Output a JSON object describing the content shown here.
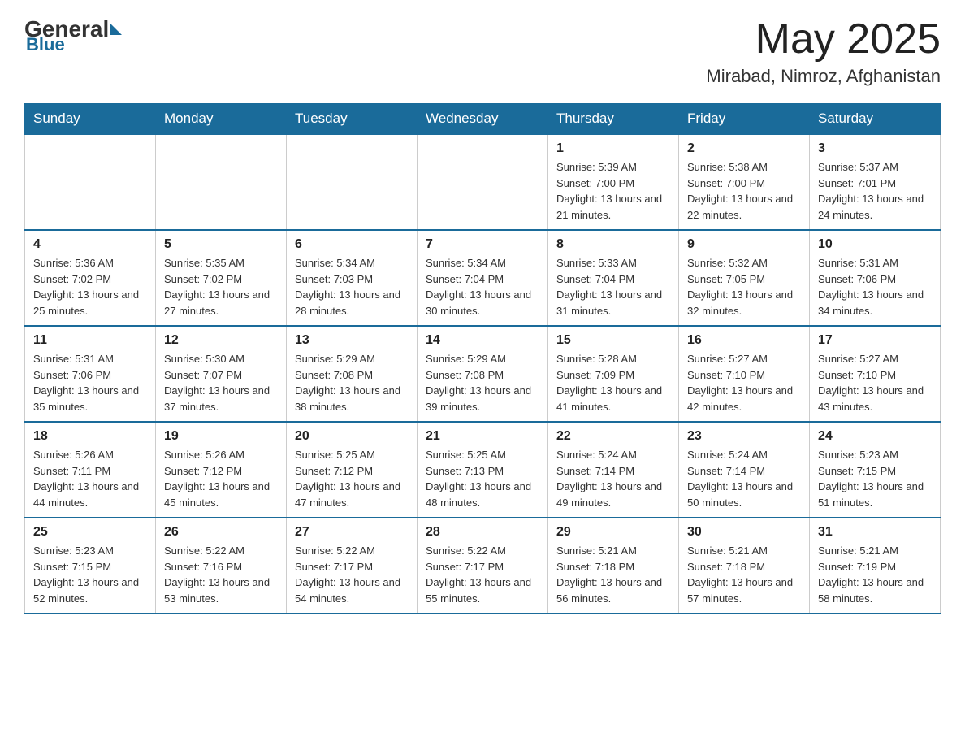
{
  "header": {
    "logo_general": "General",
    "logo_blue": "Blue",
    "month_year": "May 2025",
    "location": "Mirabad, Nimroz, Afghanistan"
  },
  "weekdays": [
    "Sunday",
    "Monday",
    "Tuesday",
    "Wednesday",
    "Thursday",
    "Friday",
    "Saturday"
  ],
  "weeks": [
    [
      {
        "day": "",
        "info": ""
      },
      {
        "day": "",
        "info": ""
      },
      {
        "day": "",
        "info": ""
      },
      {
        "day": "",
        "info": ""
      },
      {
        "day": "1",
        "info": "Sunrise: 5:39 AM\nSunset: 7:00 PM\nDaylight: 13 hours and 21 minutes."
      },
      {
        "day": "2",
        "info": "Sunrise: 5:38 AM\nSunset: 7:00 PM\nDaylight: 13 hours and 22 minutes."
      },
      {
        "day": "3",
        "info": "Sunrise: 5:37 AM\nSunset: 7:01 PM\nDaylight: 13 hours and 24 minutes."
      }
    ],
    [
      {
        "day": "4",
        "info": "Sunrise: 5:36 AM\nSunset: 7:02 PM\nDaylight: 13 hours and 25 minutes."
      },
      {
        "day": "5",
        "info": "Sunrise: 5:35 AM\nSunset: 7:02 PM\nDaylight: 13 hours and 27 minutes."
      },
      {
        "day": "6",
        "info": "Sunrise: 5:34 AM\nSunset: 7:03 PM\nDaylight: 13 hours and 28 minutes."
      },
      {
        "day": "7",
        "info": "Sunrise: 5:34 AM\nSunset: 7:04 PM\nDaylight: 13 hours and 30 minutes."
      },
      {
        "day": "8",
        "info": "Sunrise: 5:33 AM\nSunset: 7:04 PM\nDaylight: 13 hours and 31 minutes."
      },
      {
        "day": "9",
        "info": "Sunrise: 5:32 AM\nSunset: 7:05 PM\nDaylight: 13 hours and 32 minutes."
      },
      {
        "day": "10",
        "info": "Sunrise: 5:31 AM\nSunset: 7:06 PM\nDaylight: 13 hours and 34 minutes."
      }
    ],
    [
      {
        "day": "11",
        "info": "Sunrise: 5:31 AM\nSunset: 7:06 PM\nDaylight: 13 hours and 35 minutes."
      },
      {
        "day": "12",
        "info": "Sunrise: 5:30 AM\nSunset: 7:07 PM\nDaylight: 13 hours and 37 minutes."
      },
      {
        "day": "13",
        "info": "Sunrise: 5:29 AM\nSunset: 7:08 PM\nDaylight: 13 hours and 38 minutes."
      },
      {
        "day": "14",
        "info": "Sunrise: 5:29 AM\nSunset: 7:08 PM\nDaylight: 13 hours and 39 minutes."
      },
      {
        "day": "15",
        "info": "Sunrise: 5:28 AM\nSunset: 7:09 PM\nDaylight: 13 hours and 41 minutes."
      },
      {
        "day": "16",
        "info": "Sunrise: 5:27 AM\nSunset: 7:10 PM\nDaylight: 13 hours and 42 minutes."
      },
      {
        "day": "17",
        "info": "Sunrise: 5:27 AM\nSunset: 7:10 PM\nDaylight: 13 hours and 43 minutes."
      }
    ],
    [
      {
        "day": "18",
        "info": "Sunrise: 5:26 AM\nSunset: 7:11 PM\nDaylight: 13 hours and 44 minutes."
      },
      {
        "day": "19",
        "info": "Sunrise: 5:26 AM\nSunset: 7:12 PM\nDaylight: 13 hours and 45 minutes."
      },
      {
        "day": "20",
        "info": "Sunrise: 5:25 AM\nSunset: 7:12 PM\nDaylight: 13 hours and 47 minutes."
      },
      {
        "day": "21",
        "info": "Sunrise: 5:25 AM\nSunset: 7:13 PM\nDaylight: 13 hours and 48 minutes."
      },
      {
        "day": "22",
        "info": "Sunrise: 5:24 AM\nSunset: 7:14 PM\nDaylight: 13 hours and 49 minutes."
      },
      {
        "day": "23",
        "info": "Sunrise: 5:24 AM\nSunset: 7:14 PM\nDaylight: 13 hours and 50 minutes."
      },
      {
        "day": "24",
        "info": "Sunrise: 5:23 AM\nSunset: 7:15 PM\nDaylight: 13 hours and 51 minutes."
      }
    ],
    [
      {
        "day": "25",
        "info": "Sunrise: 5:23 AM\nSunset: 7:15 PM\nDaylight: 13 hours and 52 minutes."
      },
      {
        "day": "26",
        "info": "Sunrise: 5:22 AM\nSunset: 7:16 PM\nDaylight: 13 hours and 53 minutes."
      },
      {
        "day": "27",
        "info": "Sunrise: 5:22 AM\nSunset: 7:17 PM\nDaylight: 13 hours and 54 minutes."
      },
      {
        "day": "28",
        "info": "Sunrise: 5:22 AM\nSunset: 7:17 PM\nDaylight: 13 hours and 55 minutes."
      },
      {
        "day": "29",
        "info": "Sunrise: 5:21 AM\nSunset: 7:18 PM\nDaylight: 13 hours and 56 minutes."
      },
      {
        "day": "30",
        "info": "Sunrise: 5:21 AM\nSunset: 7:18 PM\nDaylight: 13 hours and 57 minutes."
      },
      {
        "day": "31",
        "info": "Sunrise: 5:21 AM\nSunset: 7:19 PM\nDaylight: 13 hours and 58 minutes."
      }
    ]
  ]
}
